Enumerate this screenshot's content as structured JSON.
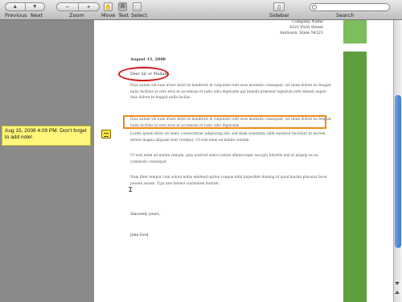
{
  "toolbar": {
    "previous_label": "Previous",
    "next_label": "Next",
    "zoom_label": "Zoom",
    "zoom_out": "−",
    "zoom_in": "+",
    "move_label": "Move",
    "text_label": "Text",
    "select_label": "Select",
    "sidebar_label": "Sidebar",
    "search_label": "Search",
    "search_placeholder": ""
  },
  "letter": {
    "sender_line1": "Company Name",
    "sender_line2": "4321 First Street",
    "sender_line3": "Anytown, State 54321",
    "date": "August 15, 2008",
    "greeting": "Dear Sir or Madam,",
    "para1": "Duis autem vel eum iriure dolor in hendrerit in vulputate velit esse molestie consequat, vel illum dolore eu feugiat nulla facilisis at vero eros et accumsan et iusto odio dignissim qui blandit praesent luptatum zzril delenit augue duis dolore te feugait nulla facilisi.",
    "para2": "Duis autem vel eum iriure dolor in hendrerit in vulputate velit esse molestie consequat, vel illum dolore eu feugiat nulla facilisis at vero eros et accumsan et iusto odio dignissim.",
    "para3": "Lorem ipsum dolor sit amet, consectetuer adipiscing elit, sed diam nonummy nibh euismod tincidunt ut laoreet dolore magna aliquam erat volutpat. Ut wisi enim ad minim veniam.",
    "para4": "Ut wisi enim ad minim veniam, quis nostrud exerci tation ullamcorper suscipit lobortis nisl ut aliquip ex ea commodo consequat.",
    "para5": "Nam liber tempor cum soluta nobis eleifend option congue nihil imperdiet doming id quod mazim placerat facer possim assum. Typi non habent claritatem insitam.",
    "closing": "Sincerely yours,",
    "signature": "John Ford"
  },
  "note": {
    "text": "Aug 15, 2008 4:09 PM: Don't forget to add note!"
  },
  "colors": {
    "ellipse": "#d4161c",
    "rectangle": "#f08a1c",
    "note_bg": "#fff67c",
    "green_bar": "#5e9e3e"
  }
}
